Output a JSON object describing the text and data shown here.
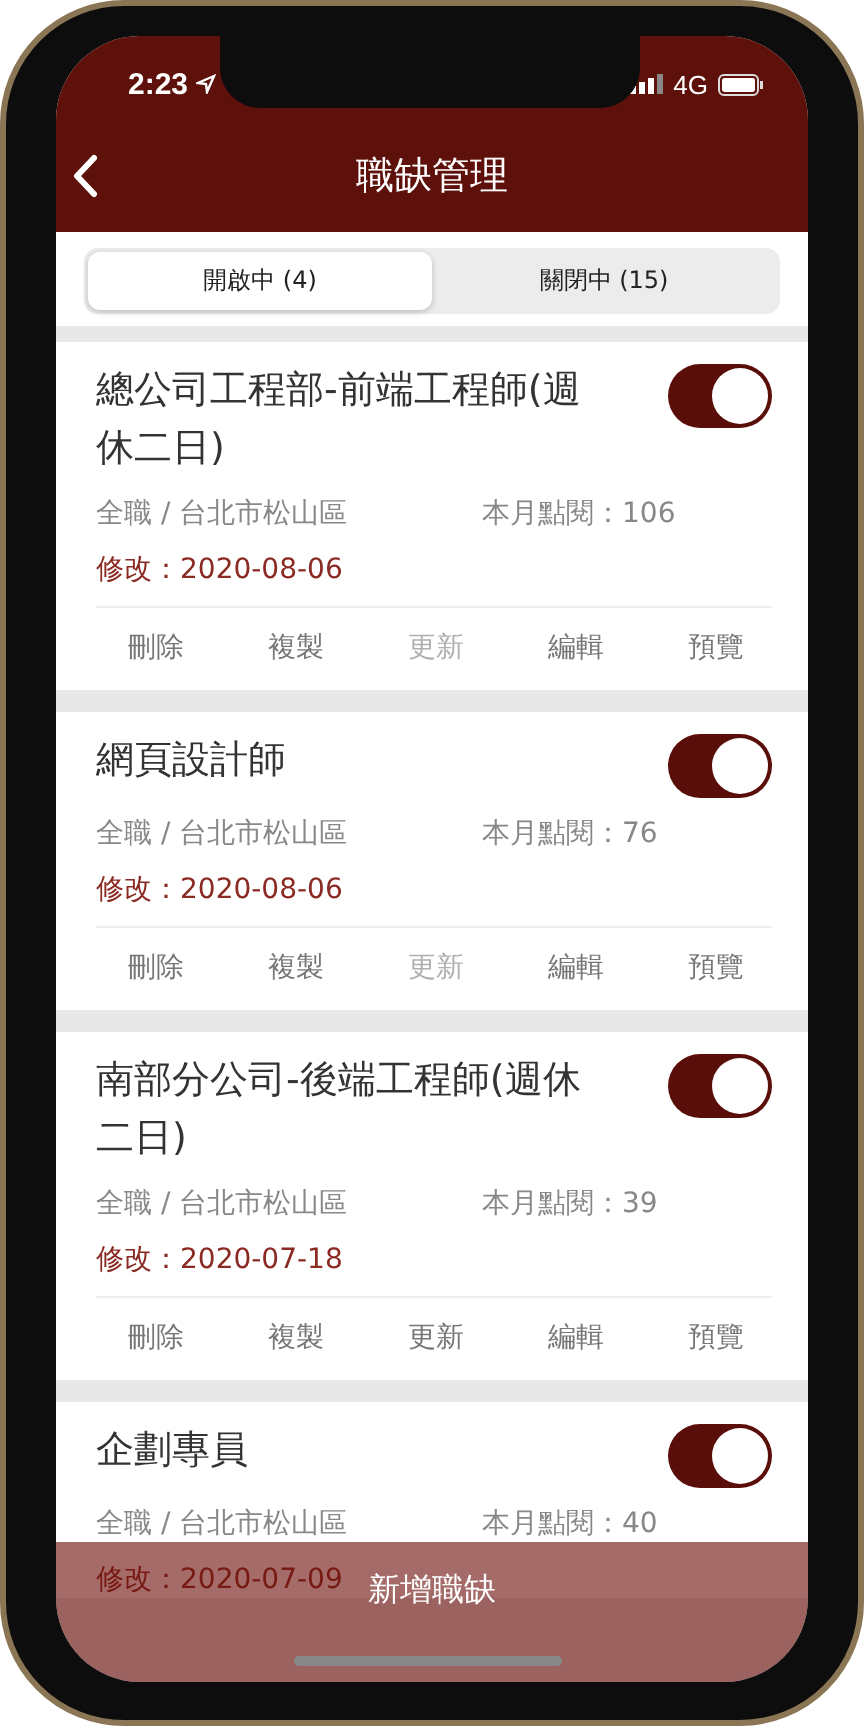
{
  "status_bar": {
    "time": "2:23",
    "network": "4G"
  },
  "header": {
    "title": "職缺管理"
  },
  "tabs": [
    {
      "label": "開啟中 (4)",
      "selected": true
    },
    {
      "label": "關閉中 (15)",
      "selected": false
    }
  ],
  "jobs": [
    {
      "title": "總公司工程部-前端工程師(週休二日)",
      "on": true,
      "meta": "全職 / 台北市松山區",
      "views": "本月點閱：106",
      "modified": "修改：2020-08-06",
      "actions": [
        {
          "label": "刪除",
          "disabled": false
        },
        {
          "label": "複製",
          "disabled": false
        },
        {
          "label": "更新",
          "disabled": true
        },
        {
          "label": "編輯",
          "disabled": false
        },
        {
          "label": "預覽",
          "disabled": false
        }
      ]
    },
    {
      "title": "網頁設計師",
      "on": true,
      "meta": "全職 / 台北市松山區",
      "views": "本月點閱：76",
      "modified": "修改：2020-08-06",
      "actions": [
        {
          "label": "刪除",
          "disabled": false
        },
        {
          "label": "複製",
          "disabled": false
        },
        {
          "label": "更新",
          "disabled": true
        },
        {
          "label": "編輯",
          "disabled": false
        },
        {
          "label": "預覽",
          "disabled": false
        }
      ]
    },
    {
      "title": "南部分公司-後端工程師(週休二日)",
      "on": true,
      "meta": "全職 / 台北市松山區",
      "views": "本月點閱：39",
      "modified": "修改：2020-07-18",
      "actions": [
        {
          "label": "刪除",
          "disabled": false
        },
        {
          "label": "複製",
          "disabled": false
        },
        {
          "label": "更新",
          "disabled": false
        },
        {
          "label": "編輯",
          "disabled": false
        },
        {
          "label": "預覽",
          "disabled": false
        }
      ]
    },
    {
      "title": "企劃專員",
      "on": true,
      "meta": "全職 / 台北市松山區",
      "views": "本月點閱：40",
      "modified": "修改：2020-07-09"
    }
  ],
  "add_button": "新增職缺"
}
